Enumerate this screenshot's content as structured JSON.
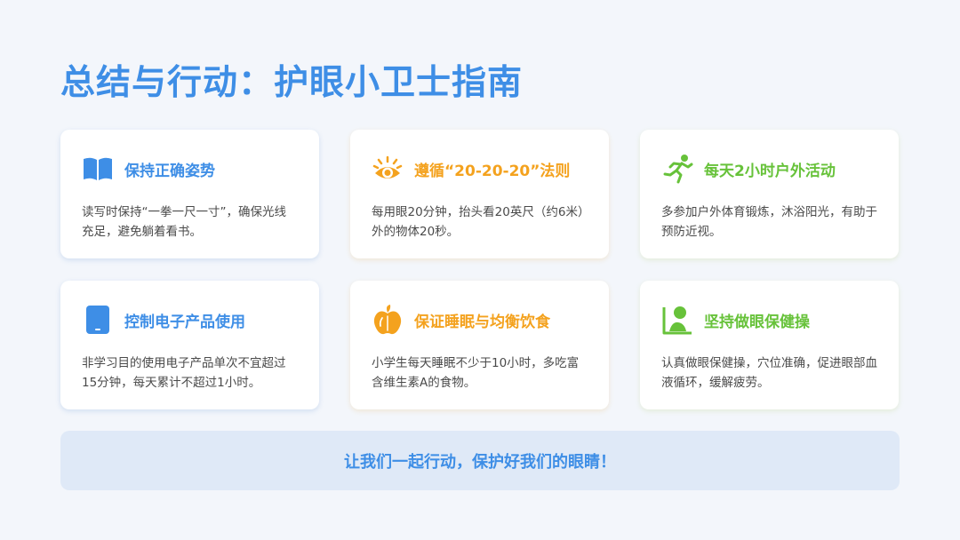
{
  "title": "总结与行动：护眼小卫士指南",
  "cards": [
    {
      "icon": "open-book-icon",
      "title": "保持正确姿势",
      "text": "读写时保持“一拳一尺一寸”，确保光线充足，避免躺着看书。",
      "color": "#3e8ee6"
    },
    {
      "icon": "eye-icon",
      "title": "遵循“20-20-20”法则",
      "text": "每用眼20分钟，抬头看20英尺（约6米）外的物体20秒。",
      "color": "#f4a21e"
    },
    {
      "icon": "running-person-icon",
      "title": "每天2小时户外活动",
      "text": "多参加户外体育锻炼，沐浴阳光，有助于预防近视。",
      "color": "#67c23a"
    },
    {
      "icon": "tablet-icon",
      "title": "控制电子产品使用",
      "text": "非学习目的使用电子产品单次不宜超过15分钟，每天累计不超过1小时。",
      "color": "#3e8ee6"
    },
    {
      "icon": "apple-icon",
      "title": "保证睡眠与均衡饮食",
      "text": "小学生每天睡眠不少于10小时，多吃富含维生素A的食物。",
      "color": "#f4a21e"
    },
    {
      "icon": "eye-exercise-icon",
      "title": "坚持做眼保健操",
      "text": "认真做眼保健操，穴位准确，促进眼部血液循环，缓解疲劳。",
      "color": "#67c23a"
    }
  ],
  "banner": "让我们一起行动，保护好我们的眼睛！"
}
